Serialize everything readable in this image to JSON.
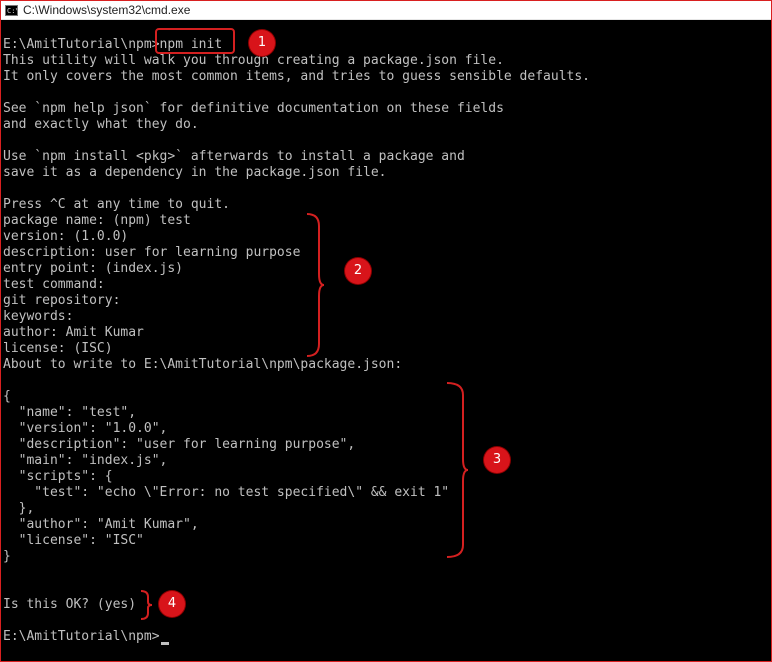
{
  "window": {
    "title": "C:\\Windows\\system32\\cmd.exe",
    "icon": "cmd-icon",
    "border_color": "#d92020"
  },
  "console": {
    "prompt": "E:\\AmitTutorial\\npm>",
    "command": "npm init",
    "lines": [
      "This utility will walk you through creating a package.json file.",
      "It only covers the most common items, and tries to guess sensible defaults.",
      "",
      "See `npm help json` for definitive documentation on these fields",
      "and exactly what they do.",
      "",
      "Use `npm install <pkg>` afterwards to install a package and",
      "save it as a dependency in the package.json file.",
      "",
      "Press ^C at any time to quit.",
      "package name: (npm) test",
      "version: (1.0.0)",
      "description: user for learning purpose",
      "entry point: (index.js)",
      "test command:",
      "git repository:",
      "keywords:",
      "author: Amit Kumar",
      "license: (ISC)",
      "About to write to E:\\AmitTutorial\\npm\\package.json:",
      "",
      "{",
      "  \"name\": \"test\",",
      "  \"version\": \"1.0.0\",",
      "  \"description\": \"user for learning purpose\",",
      "  \"main\": \"index.js\",",
      "  \"scripts\": {",
      "    \"test\": \"echo \\\"Error: no test specified\\\" && exit 1\"",
      "  },",
      "  \"author\": \"Amit Kumar\",",
      "  \"license\": \"ISC\"",
      "}",
      "",
      "",
      "Is this OK? (yes)",
      "",
      "E:\\AmitTutorial\\npm>"
    ],
    "text_color": "#c0c0c0",
    "background": "#000000"
  },
  "annotations": {
    "color": "#d8141a",
    "badges": [
      "1",
      "2",
      "3",
      "4"
    ]
  }
}
